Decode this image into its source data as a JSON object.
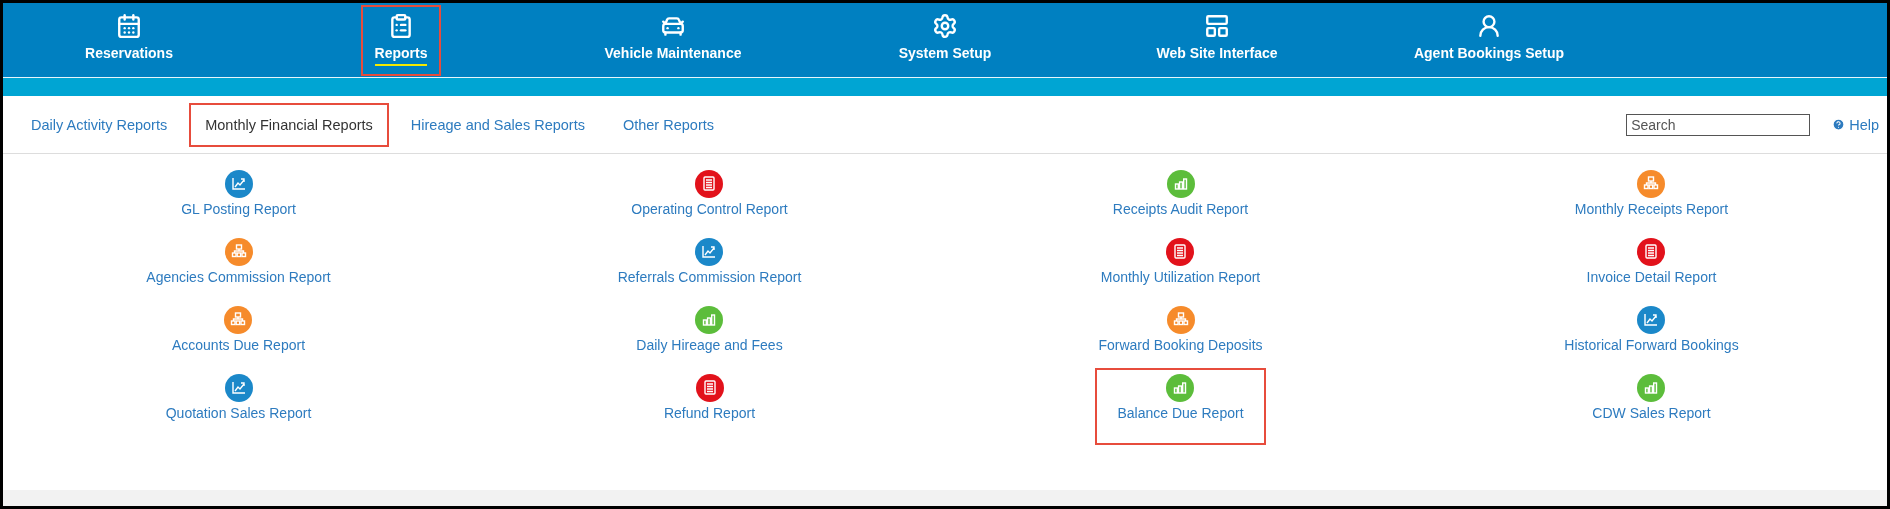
{
  "nav": [
    {
      "label": "Reservations",
      "selected": false,
      "highlighted": false
    },
    {
      "label": "Reports",
      "selected": true,
      "highlighted": true
    },
    {
      "label": "Vehicle Maintenance",
      "selected": false,
      "highlighted": false
    },
    {
      "label": "System Setup",
      "selected": false,
      "highlighted": false
    },
    {
      "label": "Web Site Interface",
      "selected": false,
      "highlighted": false
    },
    {
      "label": "Agent Bookings Setup",
      "selected": false,
      "highlighted": false
    }
  ],
  "tabs": [
    {
      "label": "Daily Activity Reports",
      "selected": false,
      "highlighted": false
    },
    {
      "label": "Monthly Financial Reports",
      "selected": true,
      "highlighted": true
    },
    {
      "label": "Hireage and Sales Reports",
      "selected": false,
      "highlighted": false
    },
    {
      "label": "Other Reports",
      "selected": false,
      "highlighted": false
    }
  ],
  "search": {
    "placeholder": "Search"
  },
  "help": {
    "label": "Help"
  },
  "reports": [
    {
      "label": "GL Posting Report",
      "kind": "chart",
      "highlighted": false
    },
    {
      "label": "Operating Control Report",
      "kind": "document",
      "highlighted": false
    },
    {
      "label": "Receipts Audit Report",
      "kind": "bars",
      "highlighted": false
    },
    {
      "label": "Monthly Receipts Report",
      "kind": "hierarchy",
      "highlighted": false
    },
    {
      "label": "Agencies Commission Report",
      "kind": "hierarchy",
      "highlighted": false
    },
    {
      "label": "Referrals Commission Report",
      "kind": "chart",
      "highlighted": false
    },
    {
      "label": "Monthly Utilization Report",
      "kind": "document",
      "highlighted": false
    },
    {
      "label": "Invoice Detail Report",
      "kind": "document",
      "highlighted": false
    },
    {
      "label": "Accounts Due Report",
      "kind": "hierarchy",
      "highlighted": false
    },
    {
      "label": "Daily Hireage and Fees",
      "kind": "bars",
      "highlighted": false
    },
    {
      "label": "Forward Booking Deposits",
      "kind": "hierarchy",
      "highlighted": false
    },
    {
      "label": "Historical Forward Bookings",
      "kind": "chart",
      "highlighted": false
    },
    {
      "label": "Quotation Sales Report",
      "kind": "chart",
      "highlighted": false
    },
    {
      "label": "Refund Report",
      "kind": "document",
      "highlighted": false
    },
    {
      "label": "Balance Due Report",
      "kind": "bars",
      "highlighted": true
    },
    {
      "label": "CDW Sales Report",
      "kind": "bars",
      "highlighted": false
    }
  ]
}
